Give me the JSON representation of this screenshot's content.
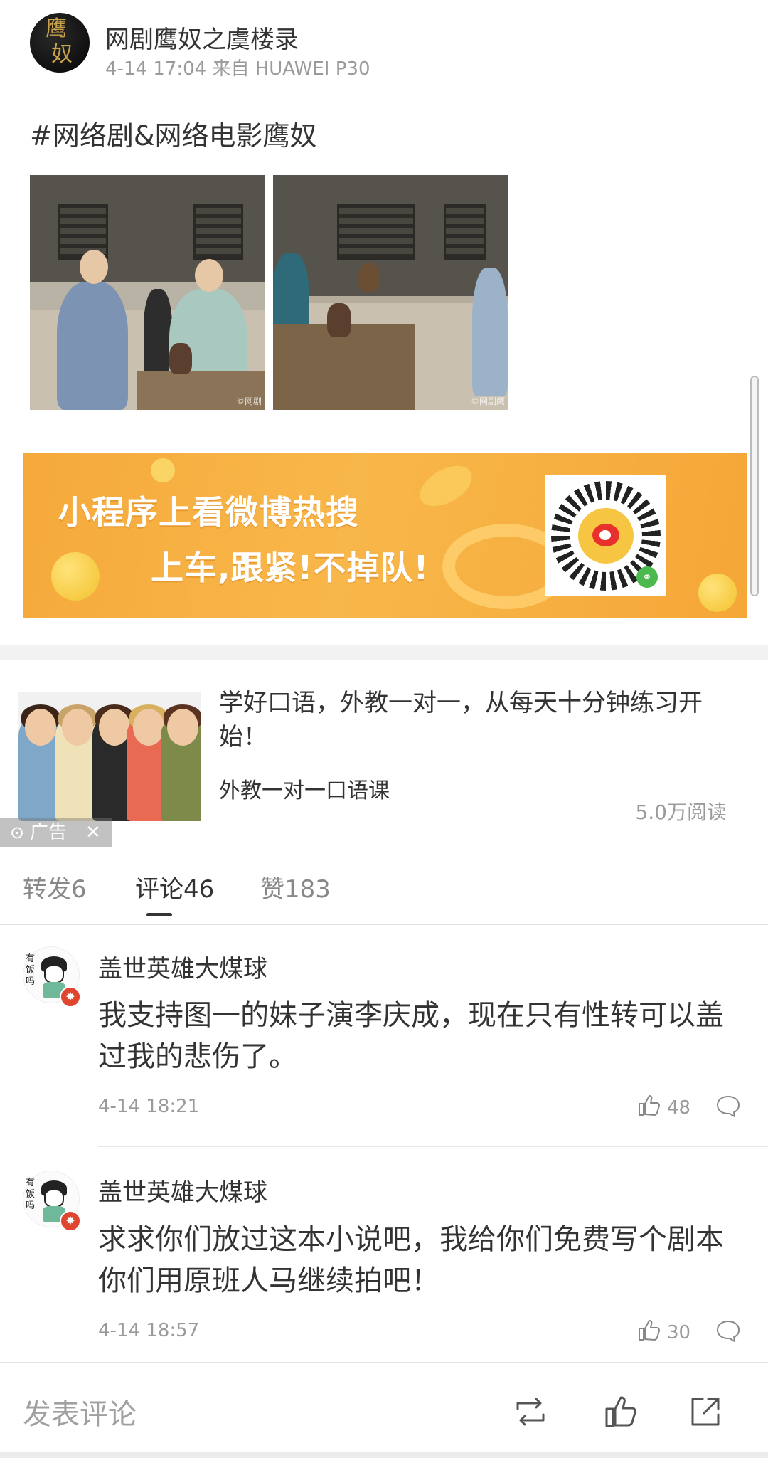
{
  "post": {
    "author_name": "网剧鹰奴之虞楼录",
    "avatar_glyph_top": "鹰",
    "avatar_glyph_bottom": "奴",
    "meta": "4-14 17:04 来自 HUAWEI P30",
    "text": "#网络剧&网络电影鹰奴",
    "photos": [
      {
        "alt": "photo-1",
        "watermark": "©网剧"
      },
      {
        "alt": "photo-2",
        "watermark": "©网剧鹰"
      }
    ]
  },
  "banner": {
    "line1": "小程序上看微博热搜",
    "line2": "上车,跟紧!不掉队!",
    "colors": {
      "bg": "#f6a93b",
      "text": "#ffffff"
    }
  },
  "ad": {
    "title": "学好口语，外教一对一，从每天十分钟练习开始！",
    "subtitle": "外教一对一口语课",
    "reads": "5.0万阅读",
    "tag_label": "广告"
  },
  "tabs": [
    {
      "label": "转发6",
      "active": false
    },
    {
      "label": "评论46",
      "active": true
    },
    {
      "label": "赞183",
      "active": false
    }
  ],
  "comments": [
    {
      "name": "盖世英雄大煤球",
      "text": "我支持图一的妹子演李庆成，现在只有性转可以盖过我的悲伤了。",
      "time": "4-14 18:21",
      "likes": "48",
      "avatar_text": "有饭吗"
    },
    {
      "name": "盖世英雄大煤球",
      "text": "求求你们放过这本小说吧，我给你们免费写个剧本你们用原班人马继续拍吧！",
      "time": "4-14 18:57",
      "likes": "30",
      "avatar_text": "有饭吗"
    }
  ],
  "bottom_bar": {
    "compose_placeholder": "发表评论",
    "icons": [
      "repost-icon",
      "like-icon",
      "share-icon"
    ]
  }
}
